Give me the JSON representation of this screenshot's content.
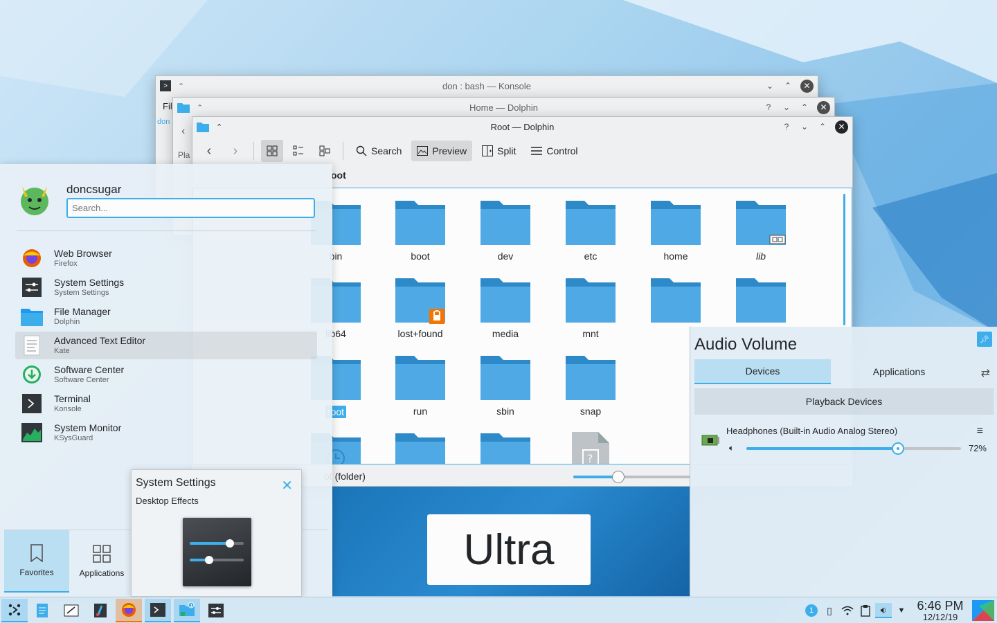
{
  "konsole": {
    "title": "don : bash — Konsole",
    "menu_partial": "Fil",
    "side_partial": "don"
  },
  "dolphin_home": {
    "title": "Home — Dolphin",
    "places_partial": "Pla"
  },
  "dolphin_root": {
    "title": "Root — Dolphin",
    "toolbar": {
      "search": "Search",
      "preview": "Preview",
      "split": "Split",
      "control": "Control"
    },
    "location_partial": "oot",
    "folders": [
      {
        "name": "bin"
      },
      {
        "name": "boot"
      },
      {
        "name": "dev"
      },
      {
        "name": "etc"
      },
      {
        "name": "home"
      },
      {
        "name": "lib"
      },
      {
        "name": "lib64"
      },
      {
        "name": "lost+found"
      },
      {
        "name": "media"
      },
      {
        "name": "mnt"
      },
      {
        "name": ""
      },
      {
        "name": ""
      },
      {
        "name": "root"
      },
      {
        "name": "run"
      },
      {
        "name": "sbin"
      },
      {
        "name": "snap"
      }
    ],
    "status_partial": "ot (folder)"
  },
  "ultra": {
    "label": "Ultra"
  },
  "launcher": {
    "username": "doncsugar",
    "search_placeholder": "Search...",
    "favorites": [
      {
        "name": "Web Browser",
        "desc": "Firefox",
        "icon": "firefox-icon"
      },
      {
        "name": "System Settings",
        "desc": "System Settings",
        "icon": "settings-icon"
      },
      {
        "name": "File Manager",
        "desc": "Dolphin",
        "icon": "folder-icon"
      },
      {
        "name": "Advanced Text Editor",
        "desc": "Kate",
        "icon": "text-editor-icon"
      },
      {
        "name": "Software Center",
        "desc": "Software Center",
        "icon": "download-icon"
      },
      {
        "name": "Terminal",
        "desc": "Konsole",
        "icon": "terminal-icon"
      },
      {
        "name": "System Monitor",
        "desc": "KSysGuard",
        "icon": "monitor-icon"
      }
    ],
    "tabs": {
      "favorites": "Favorites",
      "applications": "Applications",
      "partial": "e"
    }
  },
  "notification": {
    "title": "System Settings",
    "body": "Desktop Effects"
  },
  "audio": {
    "title": "Audio Volume",
    "tab_devices": "Devices",
    "tab_applications": "Applications",
    "section": "Playback Devices",
    "device_name": "Headphones (Built-in Audio Analog Stereo)",
    "volume_percent": "72%",
    "volume_value": 0.72
  },
  "clock": {
    "time": "6:46 PM",
    "date": "12/12/19"
  },
  "tray": {
    "notification_count": "1",
    "updates_badge": "1"
  },
  "colors": {
    "accent": "#3daee9",
    "folder": "#4fa9e4",
    "folder_dark": "#2d89c7",
    "highlight": "#f67400"
  }
}
